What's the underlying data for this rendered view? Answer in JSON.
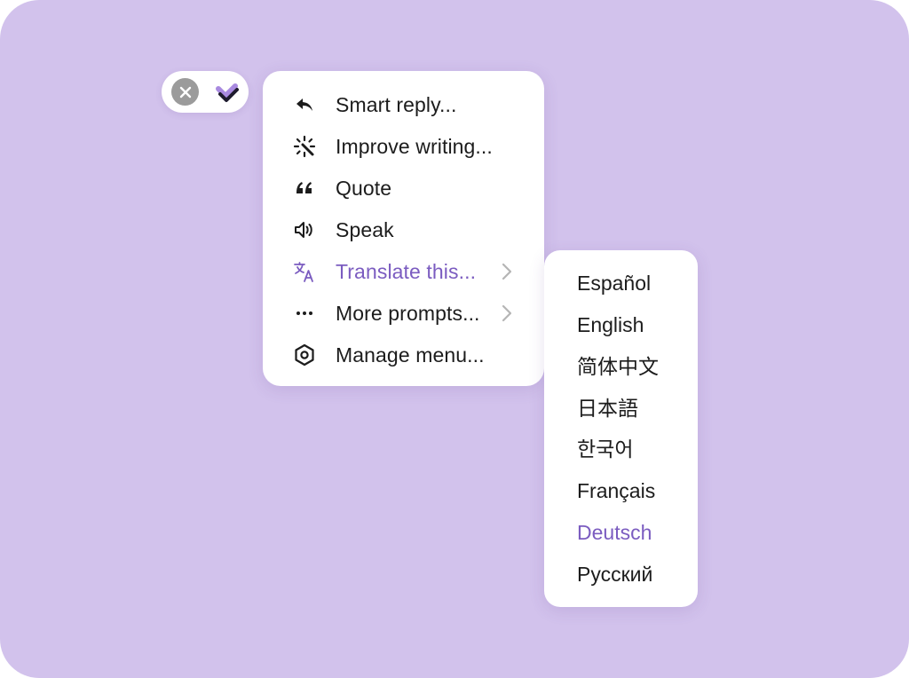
{
  "colors": {
    "background": "#d2c2ec",
    "accent": "#7b5cc0",
    "text": "#1c1c1c",
    "close_button": "#9b9b9b"
  },
  "toolbar": {
    "close_icon": "close-icon",
    "logo_icon": "app-logo-icon"
  },
  "menu": {
    "items": [
      {
        "label": "Smart reply...",
        "icon": "reply-icon"
      },
      {
        "label": "Improve writing...",
        "icon": "magic-wand-icon"
      },
      {
        "label": "Quote",
        "icon": "quote-icon"
      },
      {
        "label": "Speak",
        "icon": "speaker-icon"
      },
      {
        "label": "Translate this...",
        "icon": "translate-icon",
        "active": true,
        "has_submenu": true
      },
      {
        "label": "More prompts...",
        "icon": "more-dots-icon",
        "has_submenu": true
      },
      {
        "label": "Manage menu...",
        "icon": "hexagon-settings-icon"
      }
    ]
  },
  "submenu": {
    "languages": [
      {
        "label": "Español"
      },
      {
        "label": "English"
      },
      {
        "label": "简体中文"
      },
      {
        "label": "日本語"
      },
      {
        "label": "한국어"
      },
      {
        "label": "Français"
      },
      {
        "label": "Deutsch",
        "active": true
      },
      {
        "label": "Русский"
      }
    ]
  }
}
